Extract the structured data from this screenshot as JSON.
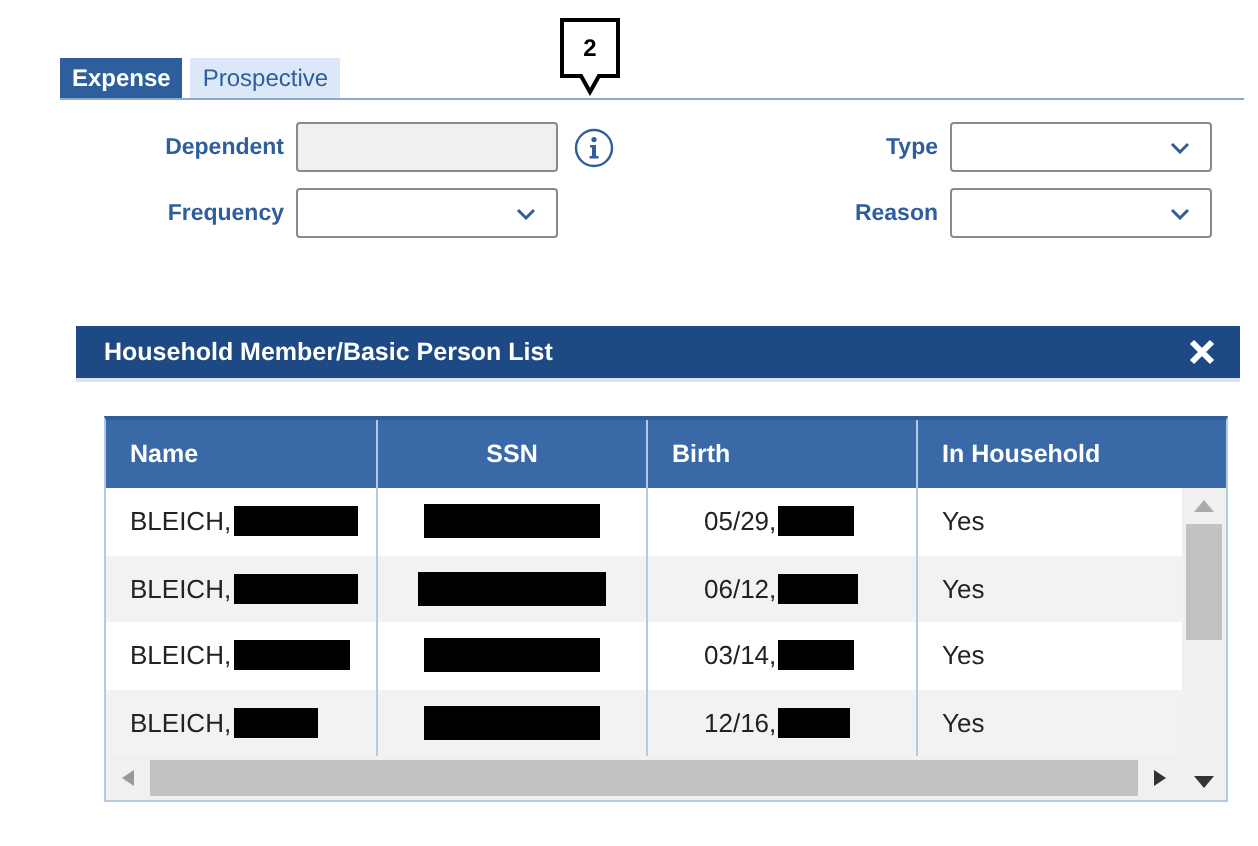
{
  "tabs": [
    {
      "label": "Expense",
      "selected": true
    },
    {
      "label": "Prospective",
      "selected": false
    }
  ],
  "callout": {
    "text": "2"
  },
  "form": {
    "left": [
      {
        "label": "Dependent",
        "kind": "text",
        "disabled": true,
        "info": true
      },
      {
        "label": "Frequency",
        "kind": "select",
        "disabled": false,
        "info": false
      }
    ],
    "right": [
      {
        "label": "Type",
        "kind": "select",
        "disabled": false,
        "info": false
      },
      {
        "label": "Reason",
        "kind": "select",
        "disabled": false,
        "info": false
      }
    ]
  },
  "dialog": {
    "title": "Household Member/Basic Person List",
    "table": {
      "columns": [
        "Name",
        "SSN",
        "Birth",
        "In Household"
      ],
      "rows": [
        {
          "name": "BLEICH,",
          "birth": "05/29,",
          "in_household": "Yes"
        },
        {
          "name": "BLEICH,",
          "birth": "06/12,",
          "in_household": "Yes"
        },
        {
          "name": "BLEICH,",
          "birth": "03/14,",
          "in_household": "Yes"
        },
        {
          "name": "BLEICH,",
          "birth": "12/16,",
          "in_household": "Yes"
        }
      ]
    }
  }
}
